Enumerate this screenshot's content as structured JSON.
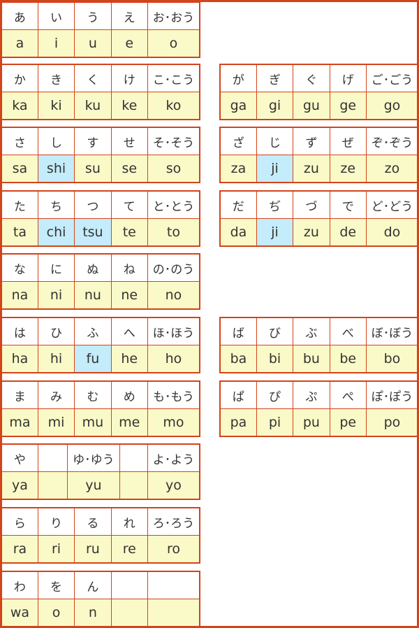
{
  "colors": {
    "border": "#d2441a",
    "romaji_bg": "#fafac8",
    "highlight_bg": "#c4ecfa"
  },
  "groups": [
    {
      "left": {
        "kana": [
          "あ",
          "い",
          "う",
          "え",
          "お･おう"
        ],
        "romaji": [
          "a",
          "i",
          "u",
          "e",
          "o"
        ],
        "highlight": []
      }
    },
    {
      "left": {
        "kana": [
          "か",
          "き",
          "く",
          "け",
          "こ･こう"
        ],
        "romaji": [
          "ka",
          "ki",
          "ku",
          "ke",
          "ko"
        ],
        "highlight": []
      },
      "right": {
        "kana": [
          "が",
          "ぎ",
          "ぐ",
          "げ",
          "ご･ごう"
        ],
        "romaji": [
          "ga",
          "gi",
          "gu",
          "ge",
          "go"
        ],
        "highlight": []
      }
    },
    {
      "left": {
        "kana": [
          "さ",
          "し",
          "す",
          "せ",
          "そ･そう"
        ],
        "romaji": [
          "sa",
          "shi",
          "su",
          "se",
          "so"
        ],
        "highlight": [
          1
        ]
      },
      "right": {
        "kana": [
          "ざ",
          "じ",
          "ず",
          "ぜ",
          "ぞ･ぞう"
        ],
        "romaji": [
          "za",
          "ji",
          "zu",
          "ze",
          "zo"
        ],
        "highlight": [
          1
        ]
      }
    },
    {
      "left": {
        "kana": [
          "た",
          "ち",
          "つ",
          "て",
          "と･とう"
        ],
        "romaji": [
          "ta",
          "chi",
          "tsu",
          "te",
          "to"
        ],
        "highlight": [
          1,
          2
        ]
      },
      "right": {
        "kana": [
          "だ",
          "ぢ",
          "づ",
          "で",
          "ど･どう"
        ],
        "romaji": [
          "da",
          "ji",
          "zu",
          "de",
          "do"
        ],
        "highlight": [
          1
        ]
      }
    },
    {
      "left": {
        "kana": [
          "な",
          "に",
          "ぬ",
          "ね",
          "の･のう"
        ],
        "romaji": [
          "na",
          "ni",
          "nu",
          "ne",
          "no"
        ],
        "highlight": []
      }
    },
    {
      "left": {
        "kana": [
          "は",
          "ひ",
          "ふ",
          "へ",
          "ほ･ほう"
        ],
        "romaji": [
          "ha",
          "hi",
          "fu",
          "he",
          "ho"
        ],
        "highlight": [
          2
        ]
      },
      "right": {
        "kana": [
          "ば",
          "び",
          "ぶ",
          "べ",
          "ぼ･ぼう"
        ],
        "romaji": [
          "ba",
          "bi",
          "bu",
          "be",
          "bo"
        ],
        "highlight": []
      }
    },
    {
      "left": {
        "kana": [
          "ま",
          "み",
          "む",
          "め",
          "も･もう"
        ],
        "romaji": [
          "ma",
          "mi",
          "mu",
          "me",
          "mo"
        ],
        "highlight": []
      },
      "right": {
        "kana": [
          "ぱ",
          "ぴ",
          "ぷ",
          "ぺ",
          "ぽ･ぽう"
        ],
        "romaji": [
          "pa",
          "pi",
          "pu",
          "pe",
          "po"
        ],
        "highlight": []
      }
    },
    {
      "left": {
        "kana": [
          "や",
          "",
          "ゆ･ゆう",
          "",
          "よ･よう"
        ],
        "romaji": [
          "ya",
          "",
          "yu",
          "",
          "yo"
        ],
        "highlight": [],
        "ya_row": true
      }
    },
    {
      "left": {
        "kana": [
          "ら",
          "り",
          "る",
          "れ",
          "ろ･ろう"
        ],
        "romaji": [
          "ra",
          "ri",
          "ru",
          "re",
          "ro"
        ],
        "highlight": []
      }
    },
    {
      "left": {
        "kana": [
          "わ",
          "を",
          "ん",
          "",
          ""
        ],
        "romaji": [
          "wa",
          "o",
          "n",
          "",
          ""
        ],
        "highlight": []
      }
    }
  ]
}
